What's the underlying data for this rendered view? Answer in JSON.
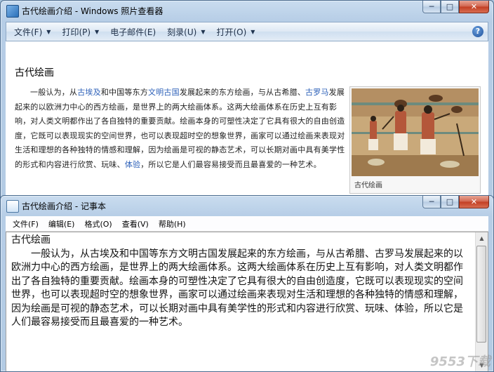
{
  "viewer": {
    "title": "古代绘画介绍 - Windows 照片查看器",
    "menu": [
      {
        "label": "文件(F)"
      },
      {
        "label": "打印(P)"
      },
      {
        "label": "电子邮件(E)"
      },
      {
        "label": "刻录(U)"
      },
      {
        "label": "打开(O)"
      }
    ],
    "help": "?",
    "article": {
      "title": "古代绘画",
      "p1": "一般认为，从",
      "link1": "古埃及",
      "p2": "和中国等东方",
      "link2": "文明古国",
      "p3": "发展起来的东方绘画，与从古希腊、",
      "link3": "古罗马",
      "p4": "发展起来的以欧洲力中心的西方绘画，是世界上的两大绘画体系。这两大绘画体系在历史上互有影响，对人类文明都作出了各自独特的重要贡献。绘画本身的可塑性决定了它具有很大的自由创造度，它既可以表现现实的空间世界，也可以表现超时空的想象世界，画家可以通过绘画来表现对生活和理想的各种独特的情感和理解，因为绘画是可视的静态艺术，可以长期对画中具有美学性的形式和内容进行欣赏、玩味、",
      "link4": "体验",
      "p5": "，所以它是人们最容易接受而且最喜爱的一种艺术。",
      "figure_caption": "古代绘画"
    }
  },
  "notepad": {
    "title": "古代绘画介绍 - 记事本",
    "menu": [
      {
        "label": "文件(F)"
      },
      {
        "label": "编辑(E)"
      },
      {
        "label": "格式(O)"
      },
      {
        "label": "查看(V)"
      },
      {
        "label": "帮助(H)"
      }
    ],
    "content": "古代绘画\n　　一般认为，从古埃及和中国等东方文明古国发展起来的东方绘画，与从古希腊、古罗马发展起来的以欧洲力中心的西方绘画，是世界上的两大绘画体系。这两大绘画体系在历史上互有影响，对人类文明都作出了各自独特的重要贡献。绘画本身的可塑性决定了它具有很大的自由创造度，它既可以表现现实的空间世界，也可以表现超时空的想象世界，画家可以通过绘画来表现对生活和理想的各种独特的情感和理解，因为绘画是可视的静态艺术，可以长期对画中具有美学性的形式和内容进行欣赏、玩味、体验，所以它是人们最容易接受而且最喜爱的一种艺术。"
  },
  "window_controls": {
    "minimize": "─",
    "maximize": "□",
    "close": "✕"
  },
  "watermark": "9553下载",
  "colors": {
    "link": "#2b5fb8",
    "close_button": "#c23d22",
    "chrome": "#b6cde6"
  }
}
